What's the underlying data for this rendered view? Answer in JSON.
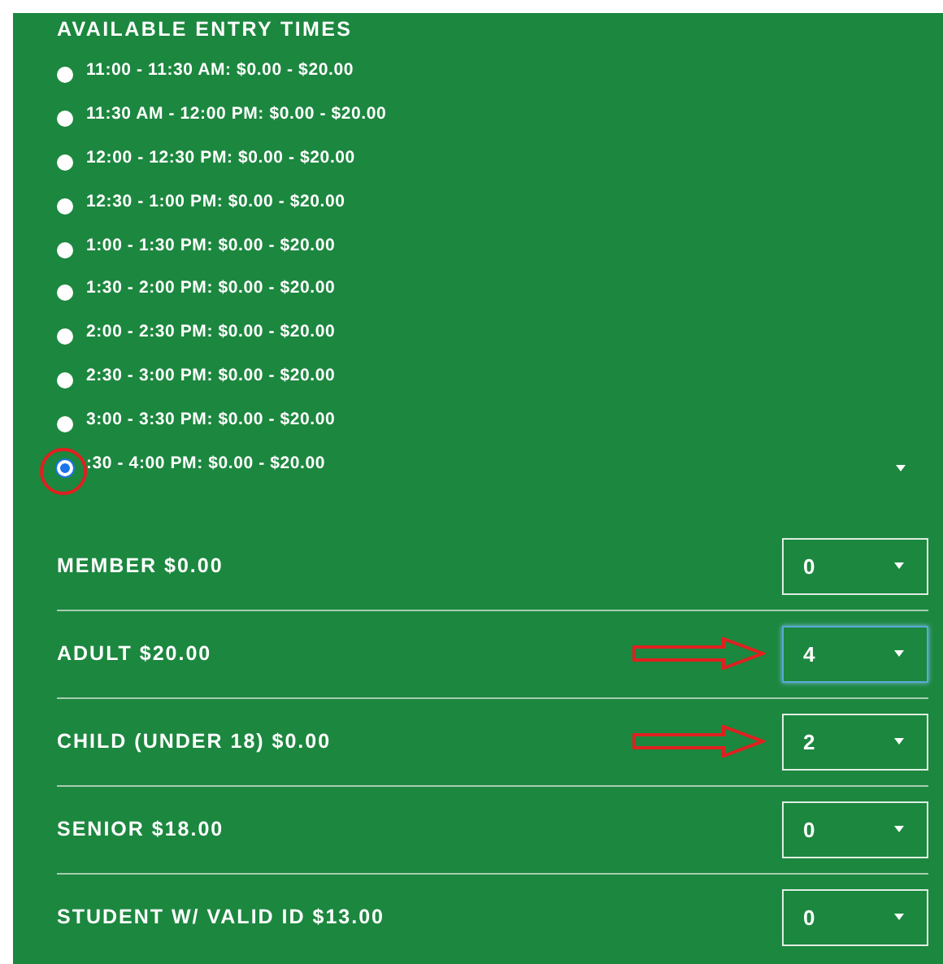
{
  "heading": "AVAILABLE ENTRY TIMES",
  "time_slots": [
    {
      "label": "11:00 - 11:30 AM: $0.00 - $20.00",
      "selected": false,
      "circled": false
    },
    {
      "label": "11:30 AM - 12:00 PM: $0.00 - $20.00",
      "selected": false,
      "circled": false
    },
    {
      "label": "12:00 - 12:30 PM: $0.00 - $20.00",
      "selected": false,
      "circled": false
    },
    {
      "label": "12:30 - 1:00 PM: $0.00 - $20.00",
      "selected": false,
      "circled": false
    },
    {
      "label": "1:00 - 1:30 PM: $0.00 - $20.00",
      "selected": false,
      "circled": false
    },
    {
      "label": "1:30 - 2:00 PM: $0.00 - $20.00",
      "selected": false,
      "circled": false
    },
    {
      "label": "2:00 - 2:30 PM: $0.00 - $20.00",
      "selected": false,
      "circled": false
    },
    {
      "label": "2:30 - 3:00 PM: $0.00 - $20.00",
      "selected": false,
      "circled": false
    },
    {
      "label": "3:00 - 3:30 PM: $0.00 - $20.00",
      "selected": false,
      "circled": false
    },
    {
      "label": ":30 - 4:00 PM: $0.00 - $20.00",
      "selected": true,
      "circled": true
    }
  ],
  "tickets": [
    {
      "label": "MEMBER $0.00",
      "quantity": "0",
      "focused": false,
      "arrow": false
    },
    {
      "label": "ADULT $20.00",
      "quantity": "4",
      "focused": true,
      "arrow": true
    },
    {
      "label": "CHILD (UNDER 18) $0.00",
      "quantity": "2",
      "focused": false,
      "arrow": true
    },
    {
      "label": "SENIOR $18.00",
      "quantity": "0",
      "focused": false,
      "arrow": false
    },
    {
      "label": "STUDENT W/ VALID ID $13.00",
      "quantity": "0",
      "focused": false,
      "arrow": false
    }
  ]
}
